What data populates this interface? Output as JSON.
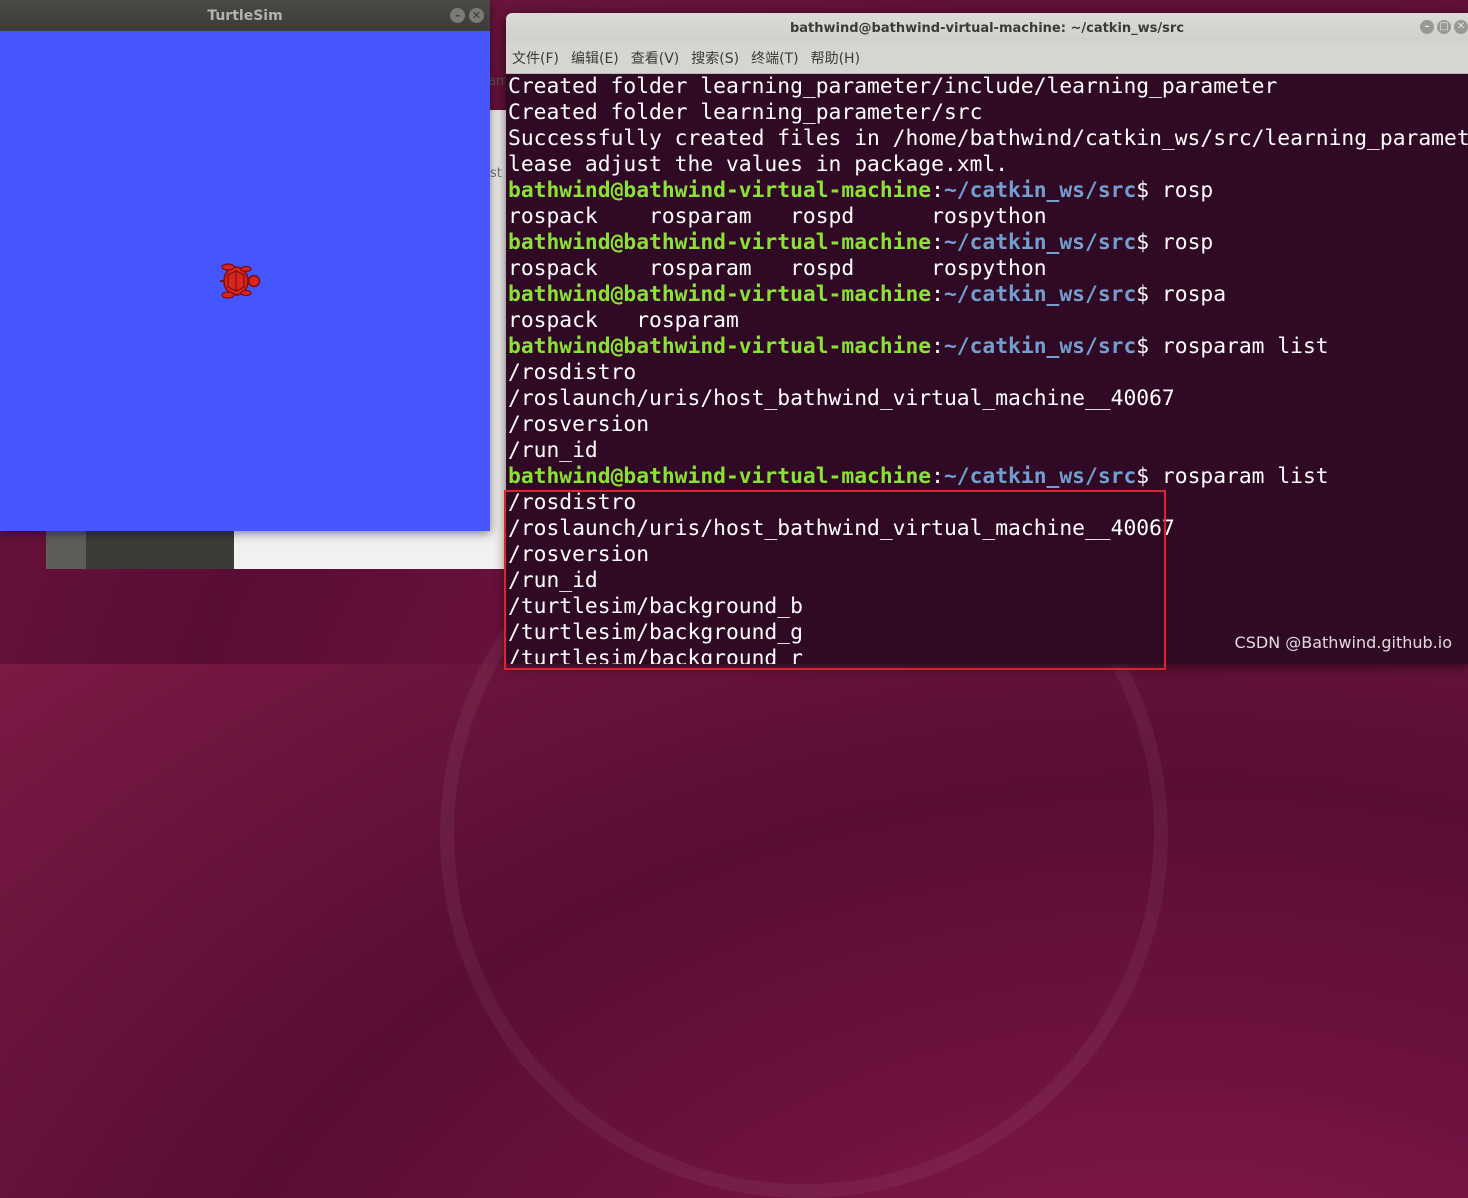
{
  "turtlesim": {
    "title": "TurtleSim",
    "background_color": "#4556ff"
  },
  "terminal": {
    "title": "bathwind@bathwind-virtual-machine: ~/catkin_ws/src",
    "menu": [
      "文件(F)",
      "编辑(E)",
      "查看(V)",
      "搜索(S)",
      "终端(T)",
      "帮助(H)"
    ],
    "prompt_user": "bathwind@bathwind-virtual-machine",
    "prompt_path": "~/catkin_ws/src",
    "lines": [
      {
        "type": "out",
        "text": "Created folder learning_parameter/include/learning_parameter"
      },
      {
        "type": "out",
        "text": "Created folder learning_parameter/src"
      },
      {
        "type": "out",
        "text": "Successfully created files in /home/bathwind/catkin_ws/src/learning_parameter. P"
      },
      {
        "type": "out",
        "text": "lease adjust the values in package.xml."
      },
      {
        "type": "cmd",
        "text": " rosp"
      },
      {
        "type": "out",
        "text": "rospack    rosparam   rospd      rospython"
      },
      {
        "type": "cmd",
        "text": " rosp"
      },
      {
        "type": "out",
        "text": "rospack    rosparam   rospd      rospython"
      },
      {
        "type": "cmd",
        "text": " rospa"
      },
      {
        "type": "out",
        "text": "rospack   rosparam"
      },
      {
        "type": "cmd",
        "text": " rosparam list"
      },
      {
        "type": "out",
        "text": "/rosdistro"
      },
      {
        "type": "out",
        "text": "/roslaunch/uris/host_bathwind_virtual_machine__40067"
      },
      {
        "type": "out",
        "text": "/rosversion"
      },
      {
        "type": "out",
        "text": "/run_id"
      },
      {
        "type": "cmd",
        "text": " rosparam list"
      },
      {
        "type": "out",
        "text": "/rosdistro"
      },
      {
        "type": "out",
        "text": "/roslaunch/uris/host_bathwind_virtual_machine__40067"
      },
      {
        "type": "out",
        "text": "/rosversion"
      },
      {
        "type": "out",
        "text": "/run_id"
      },
      {
        "type": "out",
        "text": "/turtlesim/background_b"
      },
      {
        "type": "out",
        "text": "/turtlesim/background_g"
      },
      {
        "type": "out",
        "text": "/turtlesim/background_r"
      }
    ]
  },
  "background_window": {
    "edge_text_1": "am",
    "edge_text_2": "st"
  },
  "watermark": "CSDN @Bathwind.github.io",
  "colors": {
    "terminal_bg": "#300a24",
    "prompt_user": "#8ae234",
    "prompt_path": "#729fcf",
    "highlight_box": "#d4282e"
  }
}
